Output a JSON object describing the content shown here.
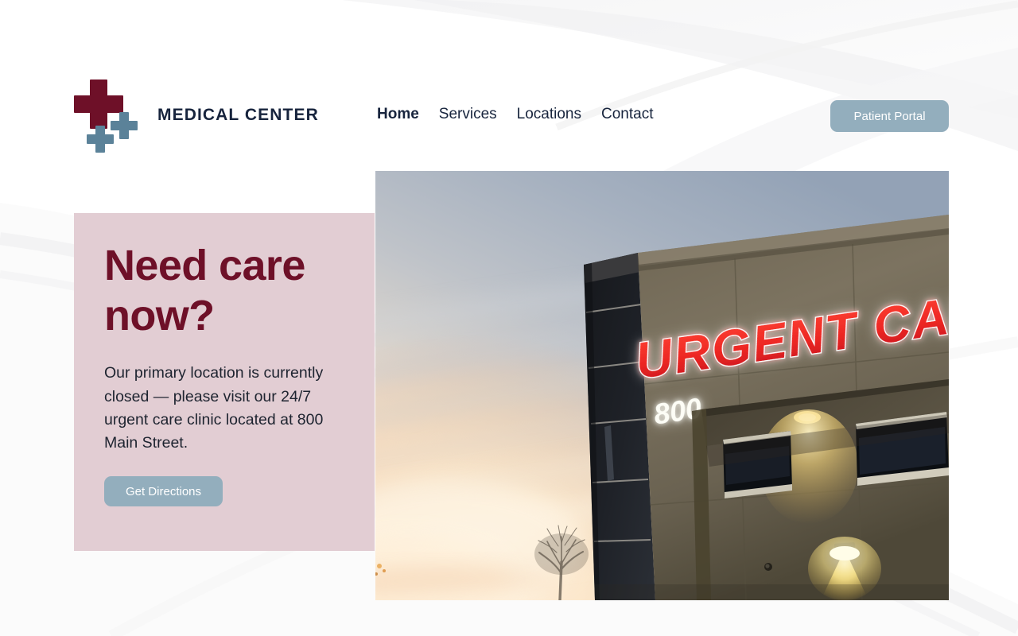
{
  "brand": {
    "name": "MEDICAL CENTER",
    "logo_icon": "medical-cross-icon",
    "primary_color": "#6E1028",
    "accent_color": "#5B8299"
  },
  "nav": {
    "items": [
      {
        "label": "Home",
        "active": true
      },
      {
        "label": "Services",
        "active": false
      },
      {
        "label": "Locations",
        "active": false
      },
      {
        "label": "Contact",
        "active": false
      }
    ]
  },
  "header": {
    "portal_button_label": "Patient Portal",
    "button_color": "#93AEBD"
  },
  "hero": {
    "title": "Need care now?",
    "body": "Our primary location is currently closed — please visit our 24/7 urgent care clinic located at 800 Main Street.",
    "cta_label": "Get Directions",
    "card_color": "#E2CDD3",
    "title_color": "#6E1028"
  },
  "photo": {
    "alt": "urgent-care-building-at-dusk",
    "sign_text": "URGENT CARE",
    "street_number": "800",
    "sign_color": "#ED2724"
  }
}
